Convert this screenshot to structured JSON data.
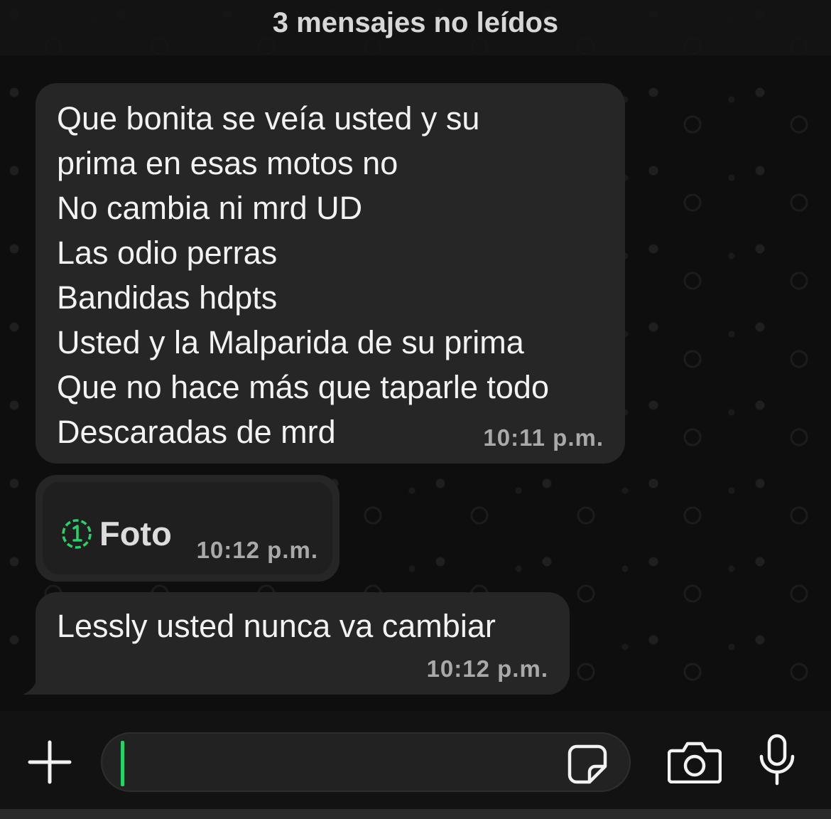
{
  "unread_banner": {
    "text": "3 mensajes no leídos"
  },
  "messages": [
    {
      "type": "text",
      "text": "Que bonita se veía usted y su\nprima en esas motos no\nNo cambia ni mrd UD\nLas odio perras\nBandidas hdpts\nUsted y la Malparida de su prima\nQue no hace más que taparle todo\nDescaradas de mrd",
      "time": "10:11 p.m."
    },
    {
      "type": "view-once-photo",
      "label": "Foto",
      "icon": "view-once-icon",
      "time": "10:12 p.m."
    },
    {
      "type": "text",
      "text": "Lessly usted nunca va cambiar",
      "time": "10:12 p.m."
    }
  ],
  "composer": {
    "input_value": "",
    "icons": [
      "plus-icon",
      "sticker-icon",
      "camera-icon",
      "microphone-icon"
    ],
    "accent_color": "#25d366"
  },
  "colors": {
    "bubble_incoming": "#262626",
    "background": "#0e0e0e",
    "timestamp": "#a9a9a9"
  }
}
